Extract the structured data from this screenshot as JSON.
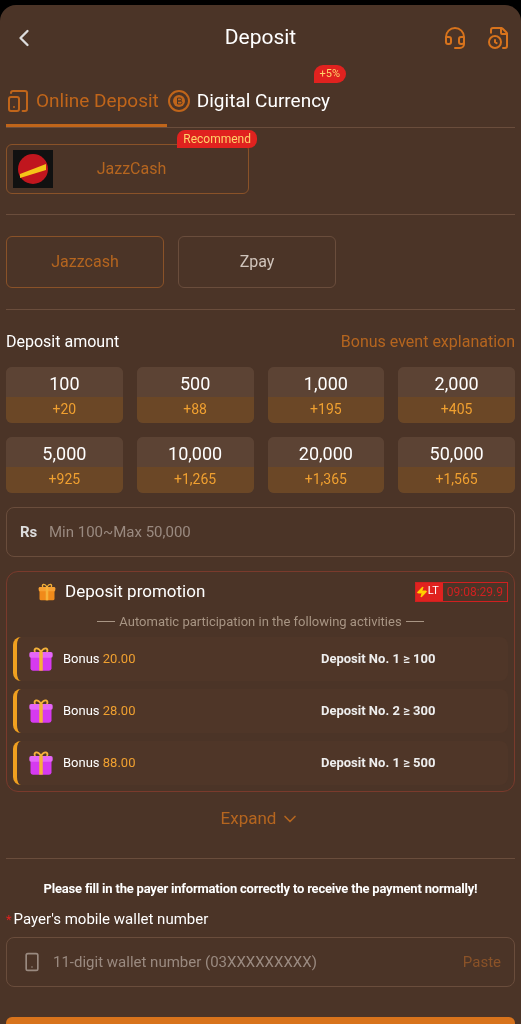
{
  "header": {
    "title": "Deposit"
  },
  "tabs": [
    {
      "label": "Online Deposit",
      "selected": true,
      "kind": "phone"
    },
    {
      "label": "Digital Currency",
      "selected": false,
      "kind": "coin",
      "badge": "+5%"
    }
  ],
  "channels": [
    {
      "name": "JazzCash",
      "badge": "Recommend",
      "selected": true
    }
  ],
  "methods": [
    {
      "label": "Jazzcash",
      "selected": true
    },
    {
      "label": "Zpay",
      "selected": false
    }
  ],
  "amount_section": {
    "title": "Deposit amount",
    "link": "Bonus event explanation"
  },
  "amounts": [
    {
      "amount": "100",
      "bonus": "+20"
    },
    {
      "amount": "500",
      "bonus": "+88"
    },
    {
      "amount": "1,000",
      "bonus": "+195"
    },
    {
      "amount": "2,000",
      "bonus": "+405"
    },
    {
      "amount": "5,000",
      "bonus": "+925"
    },
    {
      "amount": "10,000",
      "bonus": "+1,265"
    },
    {
      "amount": "20,000",
      "bonus": "+1,365"
    },
    {
      "amount": "50,000",
      "bonus": "+1,565"
    }
  ],
  "amount_field": {
    "prefix": "Rs",
    "placeholder": "Min 100~Max 50,000"
  },
  "promotion": {
    "title": "Deposit promotion",
    "tag": "LT",
    "timer": "09:08:29.9",
    "subtitle": "Automatic participation in the following activities",
    "items": [
      {
        "label": "Bonus",
        "value": "20.00",
        "condition": "Deposit No. 1 ≥ 100"
      },
      {
        "label": "Bonus",
        "value": "28.00",
        "condition": "Deposit No. 2 ≥ 300"
      },
      {
        "label": "Bonus",
        "value": "88.00",
        "condition": "Deposit No. 1 ≥ 500"
      }
    ]
  },
  "expand": {
    "label": "Expand",
    "expanded": false
  },
  "payer": {
    "notice": "Please fill in the payer information correctly to receive the payment normally!",
    "required_mark": "*",
    "label": "Payer's mobile wallet number",
    "placeholder": "11-digit wallet number (03XXXXXXXXX)",
    "action": "Paste"
  }
}
